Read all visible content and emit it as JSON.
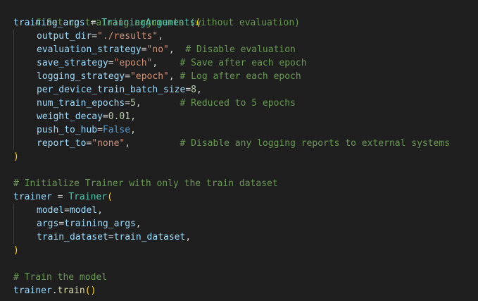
{
  "colors": {
    "background": "#1f1f1f",
    "comment": "#6a9955",
    "variable": "#9cdcfe",
    "class": "#4ec9b0",
    "function": "#dcdcaa",
    "string": "#ce9178",
    "number": "#b5cea8",
    "keyword": "#569cd6",
    "bracket": "#ffd700",
    "default": "#d4d4d4"
  },
  "code": {
    "l1": {
      "comment": "# Set up training arguments (without evaluation)"
    },
    "l2": {
      "var": "training_args",
      "op": " = ",
      "cls": "TrainingArguments",
      "paren": "("
    },
    "l3": {
      "key": "output_dir",
      "eq": "=",
      "str": "\"./results\"",
      "comma": ","
    },
    "l4": {
      "key": "evaluation_strategy",
      "eq": "=",
      "str": "\"no\"",
      "comma": ",",
      "pad": "  ",
      "comment": "# Disable evaluation"
    },
    "l5": {
      "key": "save_strategy",
      "eq": "=",
      "str": "\"epoch\"",
      "comma": ",",
      "pad": "    ",
      "comment": "# Save after each epoch"
    },
    "l6": {
      "key": "logging_strategy",
      "eq": "=",
      "str": "\"epoch\"",
      "comma": ",",
      "pad": " ",
      "comment": "# Log after each epoch"
    },
    "l7": {
      "key": "per_device_train_batch_size",
      "eq": "=",
      "num": "8",
      "comma": ","
    },
    "l8": {
      "key": "num_train_epochs",
      "eq": "=",
      "num": "5",
      "comma": ",",
      "pad": "       ",
      "comment": "# Reduced to 5 epochs"
    },
    "l9": {
      "key": "weight_decay",
      "eq": "=",
      "num": "0.01",
      "comma": ","
    },
    "l10": {
      "key": "push_to_hub",
      "eq": "=",
      "kw": "False",
      "comma": ","
    },
    "l11": {
      "key": "report_to",
      "eq": "=",
      "str": "\"none\"",
      "comma": ",",
      "pad": "         ",
      "comment": "# Disable any logging reports to external systems"
    },
    "l12": {
      "paren": ")"
    },
    "l14": {
      "comment": "# Initialize Trainer with only the train dataset"
    },
    "l15": {
      "var": "trainer",
      "op": " = ",
      "cls": "Trainer",
      "paren": "("
    },
    "l16": {
      "key": "model",
      "eq": "=",
      "val": "model",
      "comma": ","
    },
    "l17": {
      "key": "args",
      "eq": "=",
      "val": "training_args",
      "comma": ","
    },
    "l18": {
      "key": "train_dataset",
      "eq": "=",
      "val": "train_dataset",
      "comma": ","
    },
    "l19": {
      "paren": ")"
    },
    "l21": {
      "comment": "# Train the model"
    },
    "l22": {
      "var": "trainer",
      "dot": ".",
      "func": "train",
      "paren_open": "(",
      "paren_close": ")"
    }
  }
}
